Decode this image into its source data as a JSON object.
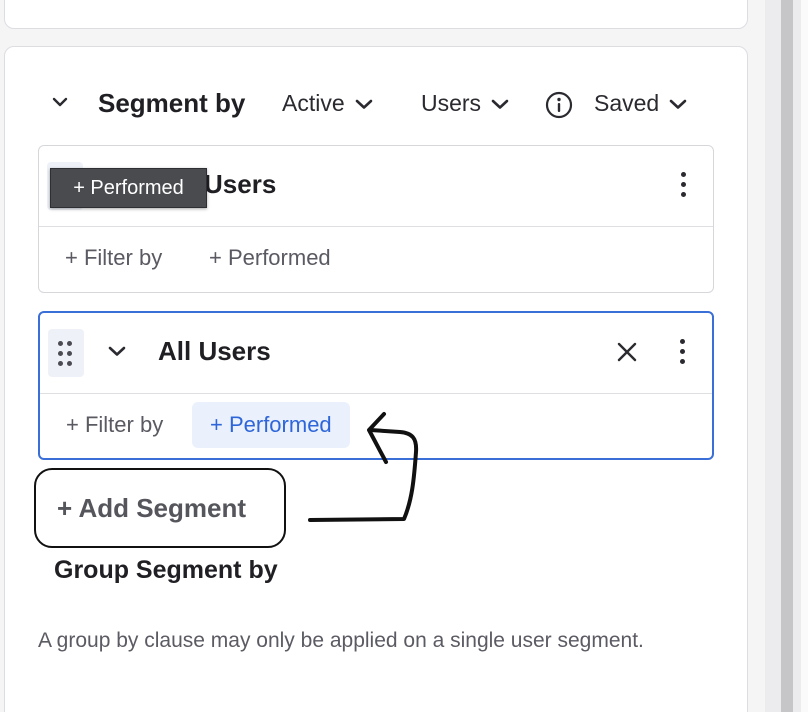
{
  "header": {
    "title": "Segment by",
    "active_dropdown": "Active",
    "users_dropdown": "Users",
    "saved_dropdown": "Saved"
  },
  "segments": [
    {
      "name": "All Users",
      "visible_name": "Users",
      "filter_label": "+ Filter by",
      "performed_label": "+ Performed"
    },
    {
      "name": "All Users",
      "filter_label": "+ Filter by",
      "performed_label": "+ Performed"
    }
  ],
  "tooltip": {
    "text": "+ Performed"
  },
  "add_segment_label": "+ Add Segment",
  "group": {
    "title": "Group Segment by",
    "note": "A group by clause may only be applied on a single user segment."
  },
  "colors": {
    "accent": "#3b6fd8",
    "accent_text": "#2e66d9",
    "accent_bg": "#eaf1fd",
    "tooltip_bg": "#4a4b4f"
  },
  "icons": {
    "collapse": "chevron-down-icon",
    "dropdown": "chevron-down-icon",
    "info": "info-icon",
    "drag": "drag-handle-icon",
    "more": "kebab-menu-icon",
    "close": "close-icon",
    "annotation": "hand-drawn-arrow"
  }
}
